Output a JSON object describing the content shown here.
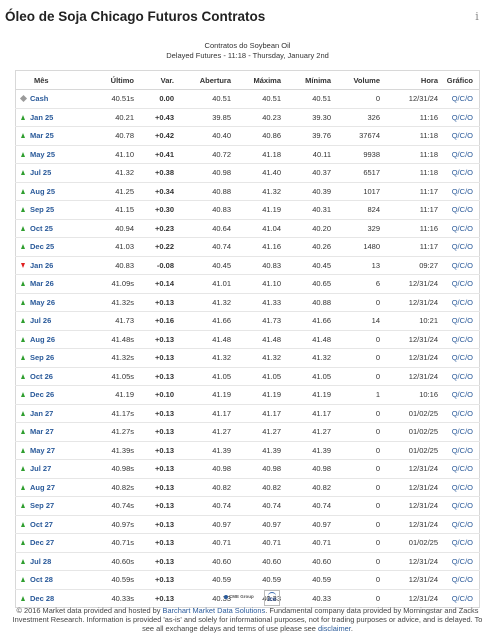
{
  "header": {
    "title": "Óleo de Soja Chicago Futuros Contratos",
    "info_glyph": "i"
  },
  "subtitle": {
    "line1": "Contratos do Soybean Oil",
    "line2": "Delayed Futures - 11:18 - Thursday, January 2nd"
  },
  "table": {
    "columns": {
      "month": "Mês",
      "last": "Último",
      "change": "Var.",
      "open": "Abertura",
      "high": "Máxima",
      "low": "Mínima",
      "volume": "Volume",
      "time": "Hora",
      "chart": "Gráfico"
    },
    "chart_links": {
      "q": "Q",
      "c": "C",
      "o": "O",
      "sep": "/"
    },
    "rows": [
      {
        "dir": "flat",
        "month": "Cash",
        "last": "40.51s",
        "change": "0.00",
        "open": "40.51",
        "high": "40.51",
        "low": "40.51",
        "volume": "0",
        "time": "12/31/24"
      },
      {
        "dir": "up",
        "month": "Jan 25",
        "last": "40.21",
        "change": "+0.43",
        "open": "39.85",
        "high": "40.23",
        "low": "39.30",
        "volume": "326",
        "time": "11:16"
      },
      {
        "dir": "up",
        "month": "Mar 25",
        "last": "40.78",
        "change": "+0.42",
        "open": "40.40",
        "high": "40.86",
        "low": "39.76",
        "volume": "37674",
        "time": "11:18"
      },
      {
        "dir": "up",
        "month": "May 25",
        "last": "41.10",
        "change": "+0.41",
        "open": "40.72",
        "high": "41.18",
        "low": "40.11",
        "volume": "9938",
        "time": "11:18"
      },
      {
        "dir": "up",
        "month": "Jul 25",
        "last": "41.32",
        "change": "+0.38",
        "open": "40.98",
        "high": "41.40",
        "low": "40.37",
        "volume": "6517",
        "time": "11:18"
      },
      {
        "dir": "up",
        "month": "Aug 25",
        "last": "41.25",
        "change": "+0.34",
        "open": "40.88",
        "high": "41.32",
        "low": "40.39",
        "volume": "1017",
        "time": "11:17"
      },
      {
        "dir": "up",
        "month": "Sep 25",
        "last": "41.15",
        "change": "+0.30",
        "open": "40.83",
        "high": "41.19",
        "low": "40.31",
        "volume": "824",
        "time": "11:17"
      },
      {
        "dir": "up",
        "month": "Oct 25",
        "last": "40.94",
        "change": "+0.23",
        "open": "40.64",
        "high": "41.04",
        "low": "40.20",
        "volume": "329",
        "time": "11:16"
      },
      {
        "dir": "up",
        "month": "Dec 25",
        "last": "41.03",
        "change": "+0.22",
        "open": "40.74",
        "high": "41.16",
        "low": "40.26",
        "volume": "1480",
        "time": "11:17"
      },
      {
        "dir": "down",
        "month": "Jan 26",
        "last": "40.83",
        "change": "-0.08",
        "open": "40.45",
        "high": "40.83",
        "low": "40.45",
        "volume": "13",
        "time": "09:27"
      },
      {
        "dir": "up",
        "month": "Mar 26",
        "last": "41.09s",
        "change": "+0.14",
        "open": "41.01",
        "high": "41.10",
        "low": "40.65",
        "volume": "6",
        "time": "12/31/24"
      },
      {
        "dir": "up",
        "month": "May 26",
        "last": "41.32s",
        "change": "+0.13",
        "open": "41.32",
        "high": "41.33",
        "low": "40.88",
        "volume": "0",
        "time": "12/31/24"
      },
      {
        "dir": "up",
        "month": "Jul 26",
        "last": "41.73",
        "change": "+0.16",
        "open": "41.66",
        "high": "41.73",
        "low": "41.66",
        "volume": "14",
        "time": "10:21"
      },
      {
        "dir": "up",
        "month": "Aug 26",
        "last": "41.48s",
        "change": "+0.13",
        "open": "41.48",
        "high": "41.48",
        "low": "41.48",
        "volume": "0",
        "time": "12/31/24"
      },
      {
        "dir": "up",
        "month": "Sep 26",
        "last": "41.32s",
        "change": "+0.13",
        "open": "41.32",
        "high": "41.32",
        "low": "41.32",
        "volume": "0",
        "time": "12/31/24"
      },
      {
        "dir": "up",
        "month": "Oct 26",
        "last": "41.05s",
        "change": "+0.13",
        "open": "41.05",
        "high": "41.05",
        "low": "41.05",
        "volume": "0",
        "time": "12/31/24"
      },
      {
        "dir": "up",
        "month": "Dec 26",
        "last": "41.19",
        "change": "+0.10",
        "open": "41.19",
        "high": "41.19",
        "low": "41.19",
        "volume": "1",
        "time": "10:16"
      },
      {
        "dir": "up",
        "month": "Jan 27",
        "last": "41.17s",
        "change": "+0.13",
        "open": "41.17",
        "high": "41.17",
        "low": "41.17",
        "volume": "0",
        "time": "01/02/25"
      },
      {
        "dir": "up",
        "month": "Mar 27",
        "last": "41.27s",
        "change": "+0.13",
        "open": "41.27",
        "high": "41.27",
        "low": "41.27",
        "volume": "0",
        "time": "01/02/25"
      },
      {
        "dir": "up",
        "month": "May 27",
        "last": "41.39s",
        "change": "+0.13",
        "open": "41.39",
        "high": "41.39",
        "low": "41.39",
        "volume": "0",
        "time": "01/02/25"
      },
      {
        "dir": "up",
        "month": "Jul 27",
        "last": "40.98s",
        "change": "+0.13",
        "open": "40.98",
        "high": "40.98",
        "low": "40.98",
        "volume": "0",
        "time": "12/31/24"
      },
      {
        "dir": "up",
        "month": "Aug 27",
        "last": "40.82s",
        "change": "+0.13",
        "open": "40.82",
        "high": "40.82",
        "low": "40.82",
        "volume": "0",
        "time": "12/31/24"
      },
      {
        "dir": "up",
        "month": "Sep 27",
        "last": "40.74s",
        "change": "+0.13",
        "open": "40.74",
        "high": "40.74",
        "low": "40.74",
        "volume": "0",
        "time": "12/31/24"
      },
      {
        "dir": "up",
        "month": "Oct 27",
        "last": "40.97s",
        "change": "+0.13",
        "open": "40.97",
        "high": "40.97",
        "low": "40.97",
        "volume": "0",
        "time": "12/31/24"
      },
      {
        "dir": "up",
        "month": "Dec 27",
        "last": "40.71s",
        "change": "+0.13",
        "open": "40.71",
        "high": "40.71",
        "low": "40.71",
        "volume": "0",
        "time": "01/02/25"
      },
      {
        "dir": "up",
        "month": "Jul 28",
        "last": "40.60s",
        "change": "+0.13",
        "open": "40.60",
        "high": "40.60",
        "low": "40.60",
        "volume": "0",
        "time": "12/31/24"
      },
      {
        "dir": "up",
        "month": "Oct 28",
        "last": "40.59s",
        "change": "+0.13",
        "open": "40.59",
        "high": "40.59",
        "low": "40.59",
        "volume": "0",
        "time": "12/31/24"
      },
      {
        "dir": "up",
        "month": "Dec 28",
        "last": "40.33s",
        "change": "+0.13",
        "open": "40.33",
        "high": "40.33",
        "low": "40.33",
        "volume": "0",
        "time": "12/31/24"
      }
    ]
  },
  "logos": {
    "cme": "CME Group",
    "ice": "ice"
  },
  "footer": {
    "text1": "© 2016 Market data provided and hosted by ",
    "link1": "Barchart Market Data Solutions",
    "text2": ". Fundamental company data provided by Morningstar and Zacks Investment Research. Information is provided 'as-is' and solely for informational purposes, not for trading purposes or advice, and is delayed. To see all exchange delays and terms of use please see ",
    "link2": "disclaimer",
    "text3": "."
  },
  "colors": {
    "positive": "#2e9e2e",
    "negative": "#e02020",
    "link": "#2a5a9a",
    "neutral_marker": "#9a9a9a"
  }
}
